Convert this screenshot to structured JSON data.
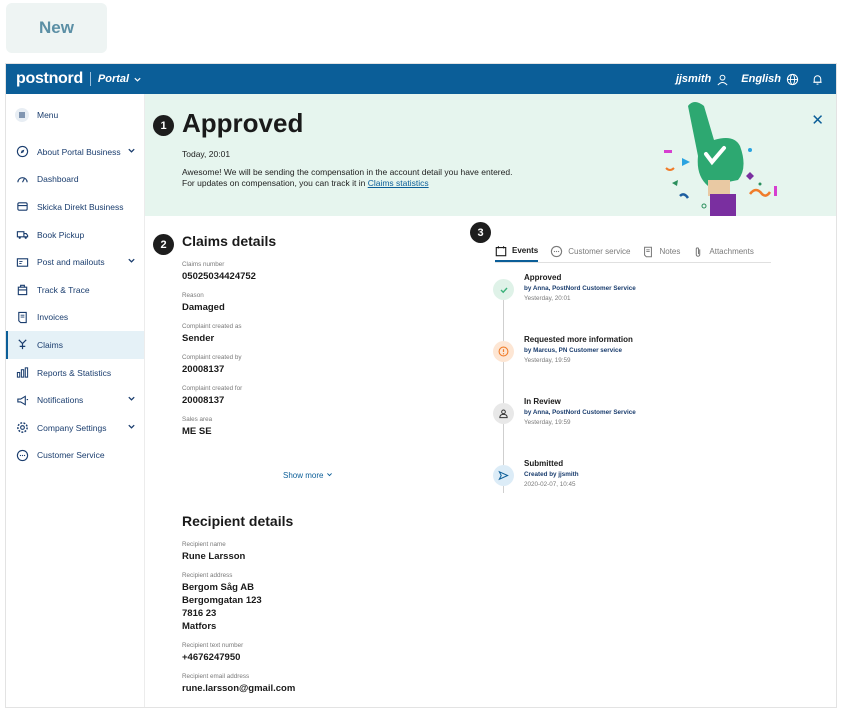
{
  "badge": "New",
  "topbar": {
    "logo": "postnord",
    "portal": "Portal",
    "user": "jjsmith",
    "language": "English"
  },
  "sidebar": {
    "menu": "Menu",
    "items": [
      {
        "label": "About Portal Business",
        "icon": "compass-icon",
        "chevron": true
      },
      {
        "label": "Dashboard",
        "icon": "dashboard-icon",
        "chevron": false
      },
      {
        "label": "Skicka Direkt Business",
        "icon": "printer-icon",
        "chevron": false
      },
      {
        "label": "Book Pickup",
        "icon": "truck-icon",
        "chevron": false
      },
      {
        "label": "Post and mailouts",
        "icon": "mail-icon",
        "chevron": true
      },
      {
        "label": "Track & Trace",
        "icon": "package-icon",
        "chevron": false
      },
      {
        "label": "Invoices",
        "icon": "invoice-icon",
        "chevron": false
      },
      {
        "label": "Claims",
        "icon": "claims-icon",
        "chevron": false,
        "active": true
      },
      {
        "label": "Reports & Statistics",
        "icon": "bar-chart-icon",
        "chevron": false
      },
      {
        "label": "Notifications",
        "icon": "megaphone-icon",
        "chevron": true
      },
      {
        "label": "Company Settings",
        "icon": "gear-icon",
        "chevron": true
      },
      {
        "label": "Customer Service",
        "icon": "chat-icon",
        "chevron": false
      }
    ]
  },
  "banner": {
    "step": "1",
    "title": "Approved",
    "time": "Today, 20:01",
    "text": "Awesome! We will be sending the compensation in the account detail you have entered. For updates on compensation, you can track it in",
    "link": "Claims statistics"
  },
  "claims": {
    "step": "2",
    "title": "Claims details",
    "fields": [
      {
        "label": "Claims number",
        "value": "05025034424752"
      },
      {
        "label": "Reason",
        "value": "Damaged"
      },
      {
        "label": "Complaint created as",
        "value": "Sender"
      },
      {
        "label": "Complaint created by",
        "value": "20008137"
      },
      {
        "label": "Complaint created for",
        "value": "20008137"
      },
      {
        "label": "Sales area",
        "value": "ME SE"
      }
    ],
    "show_more": "Show more"
  },
  "recipient": {
    "title": "Recipient details",
    "name_label": "Recipient name",
    "name": "Rune Larsson",
    "address_label": "Recipient address",
    "address_lines": [
      "Bergom Såg AB",
      "Bergomgatan 123",
      "7816 23",
      "Matfors"
    ],
    "phone_label": "Recipient text number",
    "phone": "+4676247950",
    "email_label": "Recipient email address",
    "email": "rune.larsson@gmail.com"
  },
  "history": {
    "step": "3",
    "tabs": [
      {
        "label": "Events",
        "icon": "calendar-icon",
        "active": true
      },
      {
        "label": "Customer service",
        "icon": "chat-icon",
        "active": false
      },
      {
        "label": "Notes",
        "icon": "notes-icon",
        "active": false
      },
      {
        "label": "Attachments",
        "icon": "paperclip-icon",
        "active": false
      }
    ],
    "events": [
      {
        "title": "Approved",
        "by": "by Anna, PostNord Customer Service",
        "date": "Yesterday, 20:01",
        "status": "approved"
      },
      {
        "title": "Requested more information",
        "by": "by Marcus, PN Customer service",
        "date": "Yesterday, 19:59",
        "status": "info"
      },
      {
        "title": "In Review",
        "by": "by Anna, PostNord Customer Service",
        "date": "Yesterday, 19:59",
        "status": "review"
      },
      {
        "title": "Submitted",
        "by": "Created by jjsmith",
        "date": "2020-02-07, 10:45",
        "status": "submitted"
      }
    ]
  },
  "colors": {
    "brand": "#0b5e98",
    "banner_bg": "#e6f5ee",
    "approved": "#3ab27a",
    "info": "#f07c2a"
  }
}
